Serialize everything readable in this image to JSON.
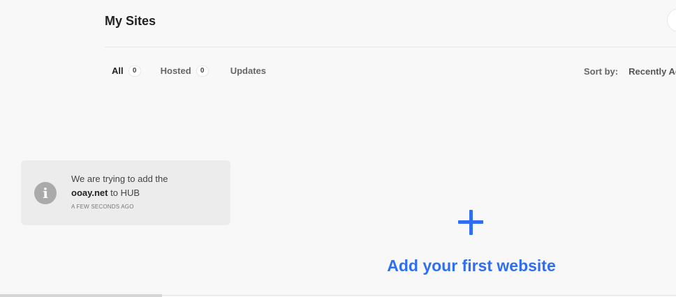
{
  "header": {
    "title": "My Sites"
  },
  "filters": {
    "tabs": [
      {
        "label": "All",
        "count": "0",
        "active": true
      },
      {
        "label": "Hosted",
        "count": "0",
        "active": false
      },
      {
        "label": "Updates",
        "active": false
      }
    ]
  },
  "sort": {
    "label": "Sort by:",
    "value": "Recently Added"
  },
  "notice": {
    "icon": "info-icon",
    "text_prefix": "We are trying to add the",
    "domain": "ooay.net",
    "text_suffix": "to HUB",
    "time": "A FEW SECONDS AGO"
  },
  "empty_state": {
    "icon": "plus-icon",
    "label": "Add your first website"
  },
  "colors": {
    "accent": "#2f6ef0",
    "background": "#f8f8f8",
    "notice_background": "#ececec",
    "info_icon": "#aaaaaa"
  }
}
